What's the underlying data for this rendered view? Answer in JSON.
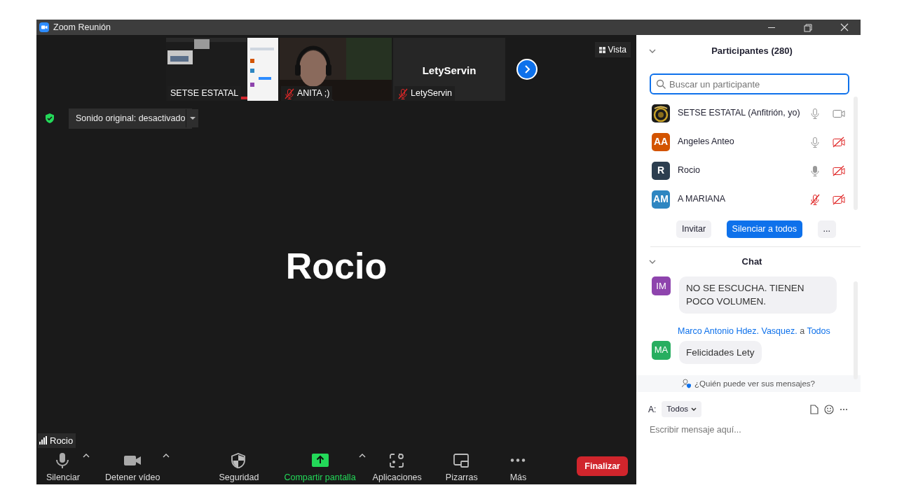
{
  "window": {
    "title": "Zoom Reunión"
  },
  "thumbnails": [
    {
      "name": "SETSE ESTATAL",
      "kind": "screen",
      "muted": false
    },
    {
      "name": "ANITA ;)",
      "kind": "camera",
      "muted": true
    },
    {
      "name": "LetyServin",
      "kind": "name",
      "display": "LetyServin",
      "muted": true
    }
  ],
  "view_button": "Vista",
  "original_sound": "Sonido original: desactivado",
  "speaker_name": "Rocio",
  "speaker_tag": "Rocio",
  "toolbar": [
    {
      "label": "Silenciar",
      "kind": "mic",
      "caret": true,
      "highlight": false
    },
    {
      "label": "Detener vídeo",
      "kind": "camera",
      "caret": true,
      "highlight": false
    },
    {
      "label": "Seguridad",
      "kind": "shield",
      "caret": false,
      "highlight": false
    },
    {
      "label": "Compartir pantalla",
      "kind": "share",
      "caret": true,
      "highlight": true
    },
    {
      "label": "Aplicaciones",
      "kind": "apps",
      "caret": false,
      "highlight": false
    },
    {
      "label": "Pizarras",
      "kind": "board",
      "caret": false,
      "highlight": false
    },
    {
      "label": "Más",
      "kind": "more",
      "caret": false,
      "highlight": false
    }
  ],
  "end_button": "Finalizar",
  "participants": {
    "title": "Participantes (280)",
    "search_placeholder": "Buscar un participante",
    "items": [
      {
        "name": "SETSE ESTATAL (Anfitrión, yo)",
        "kind": "picture",
        "muted": false,
        "speaking": false,
        "video_off": false
      },
      {
        "name": "Angeles Anteo",
        "kind": "initials",
        "initials": "AA",
        "color": "#d35400",
        "muted": false,
        "speaking": false,
        "video_off": true
      },
      {
        "name": "Rocio",
        "kind": "initials",
        "initials": "R",
        "color": "#2c3e50",
        "muted": false,
        "speaking": true,
        "video_off": true
      },
      {
        "name": "A MARIANA",
        "kind": "initials",
        "initials": "AM",
        "color": "#2e86c1",
        "muted": true,
        "speaking": false,
        "video_off": true
      }
    ],
    "buttons": [
      {
        "label": "Invitar",
        "primary": false
      },
      {
        "label": "Silenciar a todos",
        "primary": true
      },
      {
        "label": "...",
        "primary": false
      }
    ]
  },
  "chat": {
    "title": "Chat",
    "messages": [
      {
        "initials": "IM",
        "color": "#8e44ad",
        "text": "NO SE ESCUCHA. TIENEN POCO VOLUMEN."
      },
      {
        "sender": "Marco Antonio Hdez. Vasquez.",
        "to_word": "a",
        "recipient": "Todos",
        "initials": "MA",
        "color": "#27ae60",
        "text": "Felicidades Lety"
      }
    ],
    "privacy_note": "¿Quién puede ver sus mensajes?",
    "to_label": "A:",
    "to_value": "Todos",
    "placeholder": "Escribir mensaje aquí..."
  }
}
